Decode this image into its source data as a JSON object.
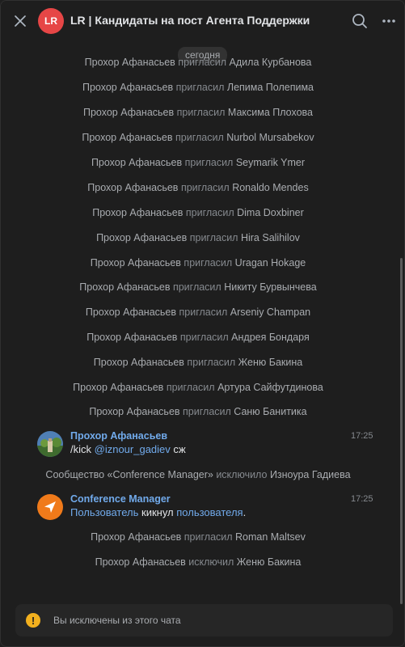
{
  "header": {
    "avatar_letter": "LR",
    "title": "LR | Кандидаты на пост Агента Поддержки"
  },
  "date_badge": "сегодня",
  "system_events": [
    {
      "actor": "Прохор Афанасьев",
      "verb": "пригласил",
      "target": "Адила Курбанова"
    },
    {
      "actor": "Прохор Афанасьев",
      "verb": "пригласил",
      "target": "Лепима Полепима"
    },
    {
      "actor": "Прохор Афанасьев",
      "verb": "пригласил",
      "target": "Максима Плохова"
    },
    {
      "actor": "Прохор Афанасьев",
      "verb": "пригласил",
      "target": "Nurbol Mursabekov"
    },
    {
      "actor": "Прохор Афанасьев",
      "verb": "пригласил",
      "target": "Seymarik Ymer"
    },
    {
      "actor": "Прохор Афанасьев",
      "verb": "пригласил",
      "target": "Ronaldo Mendes"
    },
    {
      "actor": "Прохор Афанасьев",
      "verb": "пригласил",
      "target": "Dima Doxbiner"
    },
    {
      "actor": "Прохор Афанасьев",
      "verb": "пригласил",
      "target": "Hira Salihilov"
    },
    {
      "actor": "Прохор Афанасьев",
      "verb": "пригласил",
      "target": "Uragan Hokage"
    },
    {
      "actor": "Прохор Афанасьев",
      "verb": "пригласил",
      "target": "Никиту Бурвынчева"
    },
    {
      "actor": "Прохор Афанасьев",
      "verb": "пригласил",
      "target": "Arseniy Champan"
    },
    {
      "actor": "Прохор Афанасьев",
      "verb": "пригласил",
      "target": "Андрея Бондаря"
    },
    {
      "actor": "Прохор Афанасьев",
      "verb": "пригласил",
      "target": "Женю Бакина"
    },
    {
      "actor": "Прохор Афанасьев",
      "verb": "пригласил",
      "target": "Артура Сайфутдинова"
    },
    {
      "actor": "Прохор Афанасьев",
      "verb": "пригласил",
      "target": "Саню Банитика"
    }
  ],
  "message1": {
    "author": "Прохор Афанасьев",
    "time": "17:25",
    "command": "/kick",
    "mention": "@iznour_gadiev",
    "suffix": "сж"
  },
  "kick_event": {
    "actor": "Сообщество «Conference Manager»",
    "verb": "исключило",
    "target": "Изноура Гадиева"
  },
  "message2": {
    "author": "Conference Manager",
    "time": "17:25",
    "link1": "Пользователь",
    "middle": "кикнул",
    "link2": "пользователя",
    "end": "."
  },
  "later_events": [
    {
      "actor": "Прохор Афанасьев",
      "verb": "пригласил",
      "target": "Roman Maltsev"
    },
    {
      "actor": "Прохор Афанасьев",
      "verb": "исключил",
      "target": "Женю Бакина"
    }
  ],
  "footer": {
    "info_symbol": "!",
    "text": "Вы исключены из этого чата"
  }
}
